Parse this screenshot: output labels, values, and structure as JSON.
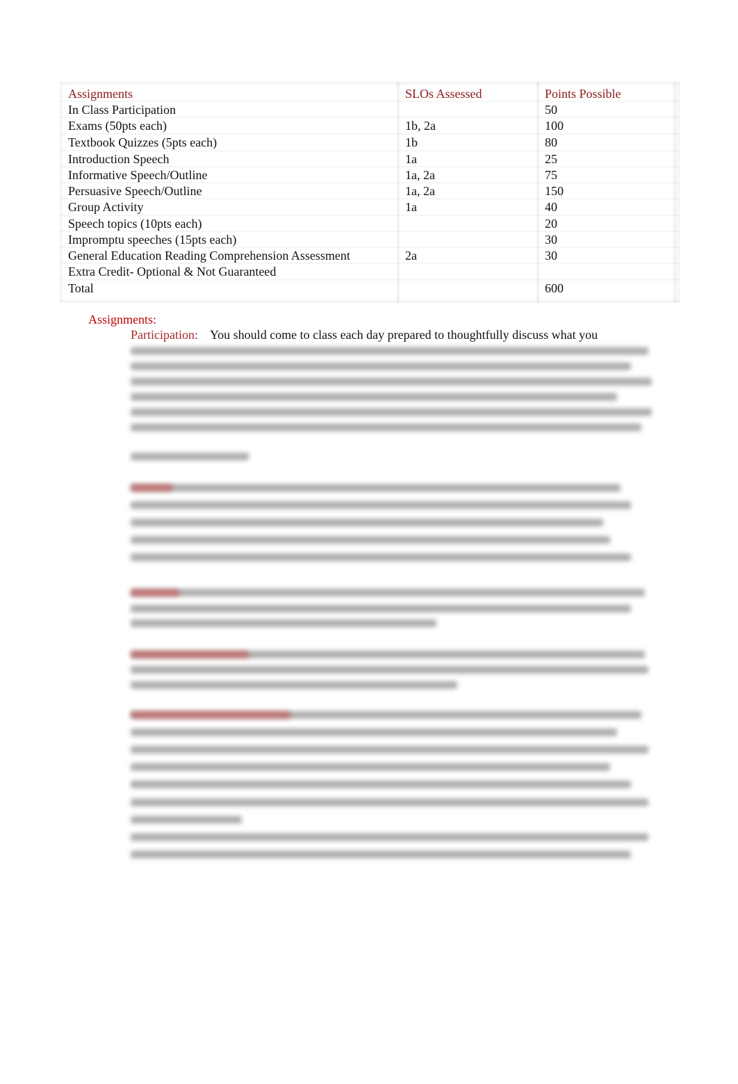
{
  "table": {
    "headers": [
      "Assignments",
      "SLOs Assessed",
      "Points Possible"
    ],
    "rows": [
      [
        "In Class Participation",
        "",
        "50"
      ],
      [
        "Exams (50pts each)",
        "1b, 2a",
        "100"
      ],
      [
        "Textbook Quizzes (5pts each)",
        "1b",
        "80"
      ],
      [
        "Introduction Speech",
        "1a",
        "25"
      ],
      [
        "Informative Speech/Outline",
        "1a, 2a",
        "75"
      ],
      [
        "Persuasive Speech/Outline",
        "1a, 2a",
        "150"
      ],
      [
        "Group Activity",
        "1a",
        "40"
      ],
      [
        "Speech topics (10pts each)",
        "",
        "20"
      ],
      [
        "Impromptu speeches (15pts each)",
        "",
        "30"
      ],
      [
        "General Education Reading Comprehension Assessment",
        "2a",
        "30"
      ],
      [
        "Extra Credit- Optional & Not Guaranteed",
        "",
        ""
      ],
      [
        "Total",
        "",
        "600"
      ]
    ]
  },
  "assignments": {
    "heading": "Assignments:",
    "participation_label": "Participation:",
    "participation_text": "You should come to class each day prepared to thoughtfully discuss what you"
  },
  "colors": {
    "header_text": "#8b1a1a",
    "section_heading": "#c00000",
    "label": "#a52a2a"
  }
}
